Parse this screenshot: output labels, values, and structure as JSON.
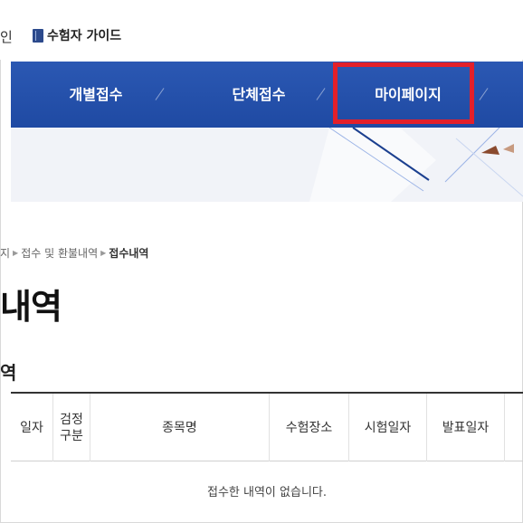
{
  "topbar": {
    "login_fragment": "인",
    "guide_label": "수험자 가이드"
  },
  "nav": {
    "items": [
      {
        "label": "개별접수"
      },
      {
        "label": "단체접수"
      },
      {
        "label": "마이페이지"
      }
    ],
    "highlight_color": "#e3202a",
    "bar_color": "#2350ad"
  },
  "breadcrumb": {
    "items": [
      "지",
      "접수 및 환불내역"
    ],
    "current": "접수내역"
  },
  "page": {
    "title": "내역",
    "section_title": "역"
  },
  "table": {
    "headers": [
      "일자",
      "검정\n구분",
      "종목명",
      "수험장소",
      "시험일자",
      "발표일자"
    ],
    "empty_message": "접수한 내역이 없습니다."
  }
}
